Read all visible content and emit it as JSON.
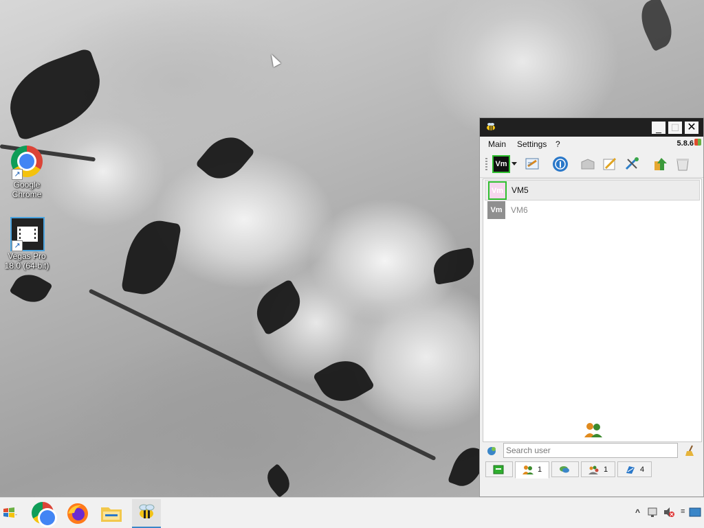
{
  "desktop": {
    "icons": [
      {
        "label": "Google Chrome",
        "icon": "chrome-icon"
      },
      {
        "label": "Vegas Pro 18.0 (64-bit)",
        "icon": "vegas-pro-icon"
      }
    ]
  },
  "window": {
    "menu": [
      "Main",
      "Settings",
      "?"
    ],
    "version": "5.8.6",
    "toolbar": [
      "vm-status-icon",
      "edit-profile-icon",
      "broadcast-icon",
      "package-icon",
      "notes-icon",
      "tools-icon",
      "transfer-icon",
      "trash-icon"
    ],
    "users": [
      {
        "name": "VM5",
        "avatar": "Vm",
        "online": true
      },
      {
        "name": "VM6",
        "avatar": "Vm",
        "online": false
      }
    ],
    "search": {
      "placeholder": "Search user"
    },
    "tabs": [
      {
        "icon": "status-icon",
        "count": ""
      },
      {
        "icon": "users-icon",
        "count": "1"
      },
      {
        "icon": "chat-icon",
        "count": ""
      },
      {
        "icon": "groups-icon",
        "count": "1"
      },
      {
        "icon": "channels-icon",
        "count": "4"
      }
    ]
  },
  "colors": {
    "titlebar": "#202020",
    "selection": "#ececec",
    "vm_online_border": "#2fbf2f"
  }
}
